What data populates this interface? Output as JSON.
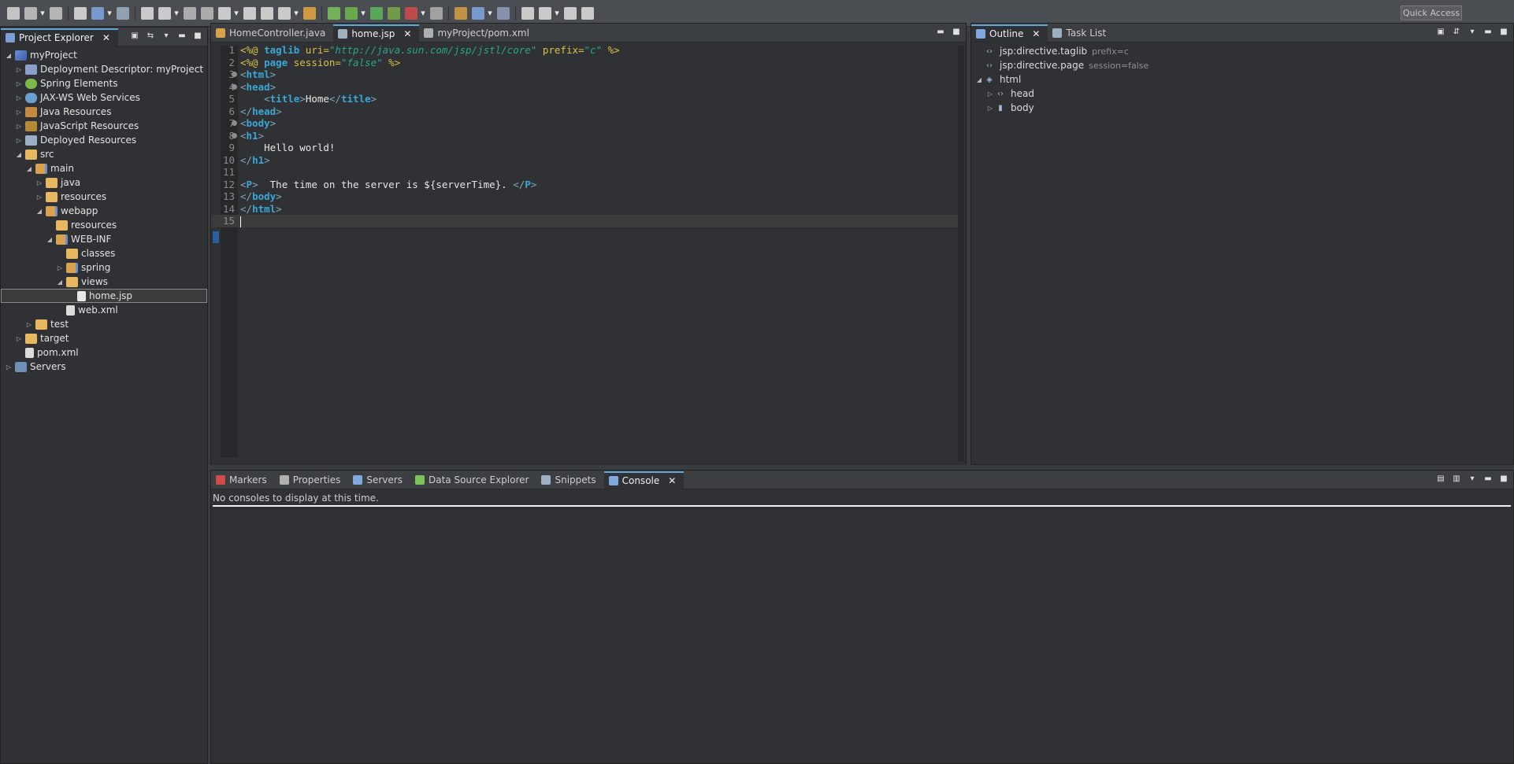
{
  "toolbar": {
    "quick_access": "Quick Access",
    "icons": [
      "new-icon",
      "save-icon",
      "save-all-icon",
      "profile-icon",
      "console-icon",
      "skip-breakpoints-icon",
      "resume-icon",
      "suspend-icon",
      "terminate-icon",
      "disconnect-icon",
      "step-into-icon",
      "step-over-icon",
      "step-return-icon",
      "drop-to-frame-icon",
      "use-step-filters-icon",
      "spring-boot-icon",
      "debug-icon",
      "run-icon",
      "coverage-icon",
      "external-tools-icon",
      "server-icon",
      "open-type-icon",
      "open-task-icon",
      "search-icon",
      "previous-annotation-icon",
      "next-annotation-icon",
      "back-icon",
      "forward-icon"
    ]
  },
  "explorer": {
    "title": "Project Explorer",
    "tree": [
      {
        "label": "myProject",
        "depth": 0,
        "twisty": "open",
        "icon": "project"
      },
      {
        "label": "Deployment Descriptor: myProject",
        "depth": 1,
        "twisty": "closed",
        "icon": "desc"
      },
      {
        "label": "Spring Elements",
        "depth": 1,
        "twisty": "closed",
        "icon": "spring"
      },
      {
        "label": "JAX-WS Web Services",
        "depth": 1,
        "twisty": "closed",
        "icon": "ws"
      },
      {
        "label": "Java Resources",
        "depth": 1,
        "twisty": "closed",
        "icon": "jar"
      },
      {
        "label": "JavaScript Resources",
        "depth": 1,
        "twisty": "closed",
        "icon": "js"
      },
      {
        "label": "Deployed Resources",
        "depth": 1,
        "twisty": "closed",
        "icon": "deployed"
      },
      {
        "label": "src",
        "depth": 1,
        "twisty": "open",
        "icon": "folder"
      },
      {
        "label": "main",
        "depth": 2,
        "twisty": "open",
        "icon": "pkgfolder"
      },
      {
        "label": "java",
        "depth": 3,
        "twisty": "closed",
        "icon": "folder"
      },
      {
        "label": "resources",
        "depth": 3,
        "twisty": "closed",
        "icon": "folder"
      },
      {
        "label": "webapp",
        "depth": 3,
        "twisty": "open",
        "icon": "pkgfolder"
      },
      {
        "label": "resources",
        "depth": 4,
        "twisty": "none",
        "icon": "folder"
      },
      {
        "label": "WEB-INF",
        "depth": 4,
        "twisty": "open",
        "icon": "pkgfolder"
      },
      {
        "label": "classes",
        "depth": 5,
        "twisty": "none",
        "icon": "folder"
      },
      {
        "label": "spring",
        "depth": 5,
        "twisty": "closed",
        "icon": "pkgfolder"
      },
      {
        "label": "views",
        "depth": 5,
        "twisty": "open",
        "icon": "folder"
      },
      {
        "label": "home.jsp",
        "depth": 6,
        "twisty": "none",
        "icon": "file",
        "selected": true
      },
      {
        "label": "web.xml",
        "depth": 5,
        "twisty": "none",
        "icon": "xml"
      },
      {
        "label": "test",
        "depth": 2,
        "twisty": "closed",
        "icon": "folder"
      },
      {
        "label": "target",
        "depth": 1,
        "twisty": "closed",
        "icon": "folder"
      },
      {
        "label": "pom.xml",
        "depth": 1,
        "twisty": "none",
        "icon": "xml"
      },
      {
        "label": "Servers",
        "depth": 0,
        "twisty": "closed",
        "icon": "servers"
      }
    ]
  },
  "editor": {
    "tabs": [
      {
        "label": "HomeController.java",
        "active": false
      },
      {
        "label": "home.jsp",
        "active": true
      },
      {
        "label": "myProject/pom.xml",
        "active": false
      }
    ],
    "lines": [
      {
        "n": "1",
        "fold": false,
        "parts": [
          [
            "dir",
            "<%@ "
          ],
          [
            "tag",
            "taglib"
          ],
          [
            "attr",
            " uri="
          ],
          [
            "str",
            "\"http://java.sun.com/jsp/jstl/core\""
          ],
          [
            "attr",
            " prefix="
          ],
          [
            "str",
            "\"c\""
          ],
          [
            "dir",
            " %>"
          ]
        ]
      },
      {
        "n": "2",
        "fold": false,
        "parts": [
          [
            "dir",
            "<%@ "
          ],
          [
            "tag",
            "page"
          ],
          [
            "attr",
            " session="
          ],
          [
            "str",
            "\"false\""
          ],
          [
            "dir",
            " %>"
          ]
        ]
      },
      {
        "n": "3",
        "fold": true,
        "parts": [
          [
            "brk",
            "<"
          ],
          [
            "tag",
            "html"
          ],
          [
            "brk",
            ">"
          ]
        ]
      },
      {
        "n": "4",
        "fold": true,
        "parts": [
          [
            "brk",
            "<"
          ],
          [
            "tag",
            "head"
          ],
          [
            "brk",
            ">"
          ]
        ]
      },
      {
        "n": "5",
        "fold": false,
        "parts": [
          [
            "txt",
            "    "
          ],
          [
            "brk",
            "<"
          ],
          [
            "tag",
            "title"
          ],
          [
            "brk",
            ">"
          ],
          [
            "txt",
            "Home"
          ],
          [
            "brk",
            "</"
          ],
          [
            "tag",
            "title"
          ],
          [
            "brk",
            ">"
          ]
        ]
      },
      {
        "n": "6",
        "fold": false,
        "parts": [
          [
            "brk",
            "</"
          ],
          [
            "tag",
            "head"
          ],
          [
            "brk",
            ">"
          ]
        ]
      },
      {
        "n": "7",
        "fold": true,
        "parts": [
          [
            "brk",
            "<"
          ],
          [
            "tag",
            "body"
          ],
          [
            "brk",
            ">"
          ]
        ]
      },
      {
        "n": "8",
        "fold": true,
        "parts": [
          [
            "brk",
            "<"
          ],
          [
            "tag",
            "h1"
          ],
          [
            "brk",
            ">"
          ]
        ]
      },
      {
        "n": "9",
        "fold": false,
        "parts": [
          [
            "txt",
            "    Hello world!"
          ]
        ]
      },
      {
        "n": "10",
        "fold": false,
        "parts": [
          [
            "brk",
            "</"
          ],
          [
            "tag",
            "h1"
          ],
          [
            "brk",
            ">"
          ]
        ]
      },
      {
        "n": "11",
        "fold": false,
        "parts": []
      },
      {
        "n": "12",
        "fold": false,
        "parts": [
          [
            "brk",
            "<"
          ],
          [
            "tag",
            "P"
          ],
          [
            "brk",
            ">"
          ],
          [
            "txt",
            "  The time on the server is ${serverTime}. "
          ],
          [
            "brk",
            "</"
          ],
          [
            "tag",
            "P"
          ],
          [
            "brk",
            ">"
          ]
        ]
      },
      {
        "n": "13",
        "fold": false,
        "parts": [
          [
            "brk",
            "</"
          ],
          [
            "tag",
            "body"
          ],
          [
            "brk",
            ">"
          ]
        ]
      },
      {
        "n": "14",
        "fold": false,
        "parts": [
          [
            "brk",
            "</"
          ],
          [
            "tag",
            "html"
          ],
          [
            "brk",
            ">"
          ]
        ]
      },
      {
        "n": "15",
        "fold": false,
        "current": true,
        "parts": []
      }
    ]
  },
  "outline": {
    "tabs": [
      {
        "label": "Outline",
        "active": true
      },
      {
        "label": "Task List",
        "active": false
      }
    ],
    "items": [
      {
        "label": "jsp:directive.taglib",
        "extra": "prefix=c",
        "depth": 0,
        "twisty": "none",
        "icon": "‹›"
      },
      {
        "label": "jsp:directive.page",
        "extra": "session=false",
        "depth": 0,
        "twisty": "none",
        "icon": "‹›"
      },
      {
        "label": "html",
        "extra": "",
        "depth": 0,
        "twisty": "open",
        "icon": "◈"
      },
      {
        "label": "head",
        "extra": "",
        "depth": 1,
        "twisty": "closed",
        "icon": "‹›"
      },
      {
        "label": "body",
        "extra": "",
        "depth": 1,
        "twisty": "closed",
        "icon": "▮"
      }
    ]
  },
  "bottom": {
    "tabs": [
      {
        "label": "Markers",
        "active": false
      },
      {
        "label": "Properties",
        "active": false
      },
      {
        "label": "Servers",
        "active": false
      },
      {
        "label": "Data Source Explorer",
        "active": false
      },
      {
        "label": "Snippets",
        "active": false
      },
      {
        "label": "Console",
        "active": true
      }
    ],
    "console_text": "No consoles to display at this time."
  },
  "colors": {
    "accent": "#5fa6d6",
    "tag": "#3aa7d6",
    "string": "#2aa58c",
    "directive": "#d6c24a"
  }
}
